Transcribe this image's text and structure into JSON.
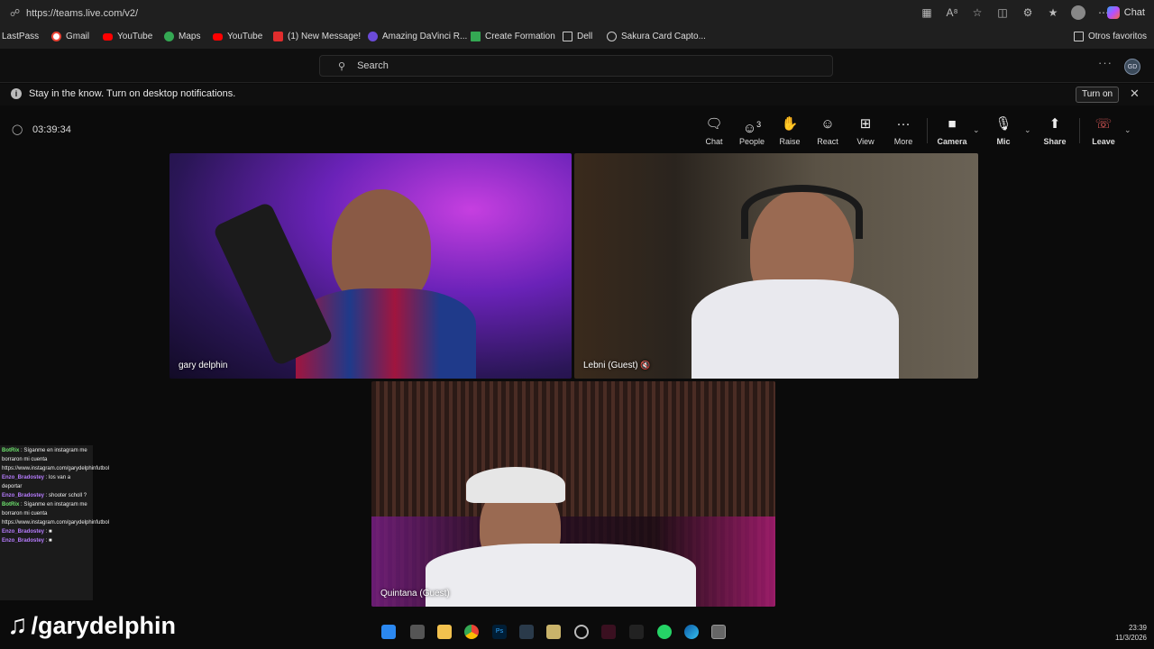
{
  "browser": {
    "url": "https://teams.live.com/v2/",
    "chat_label": "Chat",
    "bookmarks": [
      {
        "label": "LastPass"
      },
      {
        "label": "Gmail"
      },
      {
        "label": "YouTube"
      },
      {
        "label": "Maps"
      },
      {
        "label": "YouTube"
      },
      {
        "label": "(1) New Message!"
      },
      {
        "label": "Amazing DaVinci R..."
      },
      {
        "label": "Create Formation"
      },
      {
        "label": "Dell"
      },
      {
        "label": "Sakura Card Capto..."
      }
    ],
    "other_favorites": "Otros favoritos"
  },
  "teams": {
    "search_placeholder": "Search",
    "avatar_initials": "GD",
    "notification": {
      "message": "Stay in the know. Turn on desktop notifications.",
      "turn_on": "Turn on"
    },
    "meeting": {
      "timer": "03:39:34",
      "toolbar": {
        "chat": "Chat",
        "people": "People",
        "people_count": "3",
        "raise": "Raise",
        "react": "React",
        "view": "View",
        "more": "More",
        "camera": "Camera",
        "mic": "Mic",
        "share": "Share",
        "leave": "Leave"
      },
      "participants": [
        {
          "name": "gary delphin"
        },
        {
          "name": "Lebni (Guest)"
        },
        {
          "name": "Quintana (Guest)"
        }
      ]
    }
  },
  "stream_chat": [
    {
      "user": "BotRix",
      "text": ": Síganme en instagram me borraron mi cuenta https://www.instagram.com/garydelphinfutbol"
    },
    {
      "user": "Enzo_Bradostey",
      "text": ": los van a deportar"
    },
    {
      "user": "Enzo_Bradostey",
      "text": ": shooter scholl ?"
    },
    {
      "user": "BotRix",
      "text": ": Síganme en instagram me borraron mi cuenta https://www.instagram.com/garydelphinfutbol"
    },
    {
      "user": "Enzo_Bradostey",
      "text": ":"
    },
    {
      "user": "Enzo_Bradostey",
      "text": ":"
    }
  ],
  "watermark": "/garydelphin",
  "clock": {
    "time": "23:39",
    "date": "11/3/2026"
  }
}
